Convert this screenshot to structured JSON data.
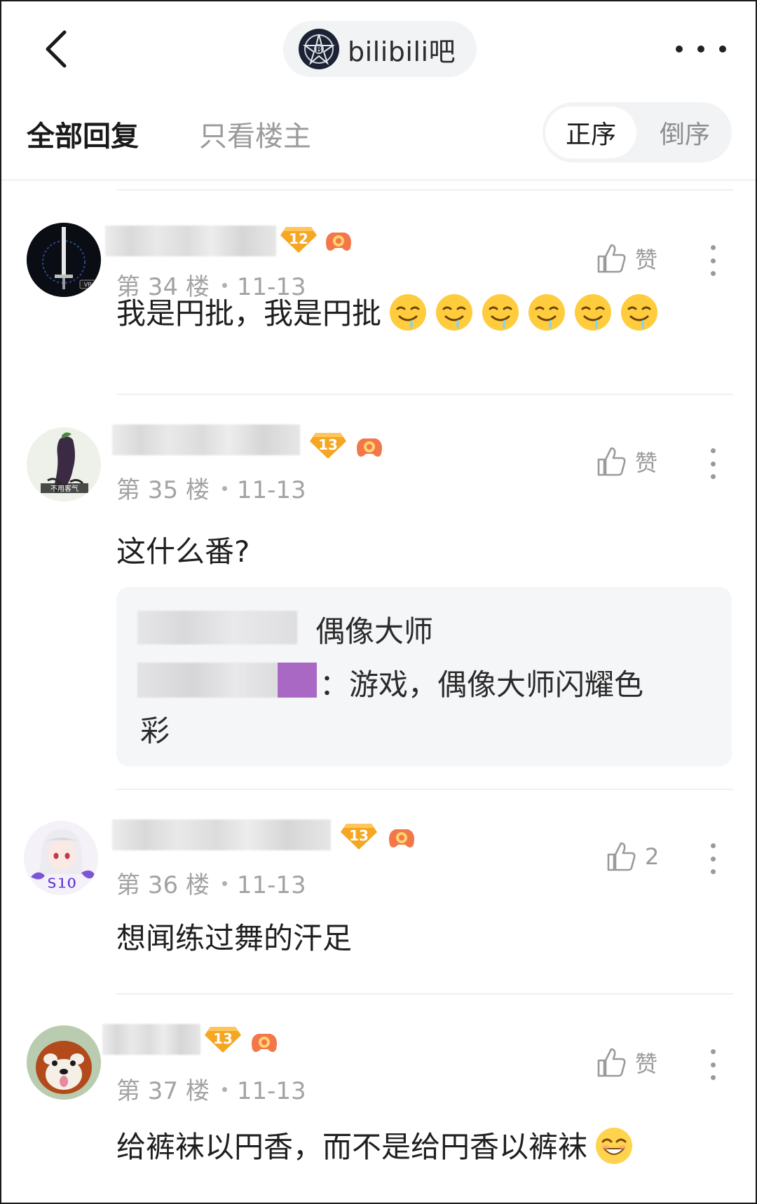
{
  "header": {
    "forum_name": "bilibili吧"
  },
  "tabs": {
    "all_replies": "全部回复",
    "owner_only": "只看楼主"
  },
  "sort": {
    "asc": "正序",
    "desc": "倒序"
  },
  "posts": [
    {
      "level": "12",
      "floor": "第 34 楼",
      "date": "11-13",
      "like": "赞",
      "text": "我是円批，我是円批",
      "emoji_count": 6,
      "emoji": "drooling-face"
    },
    {
      "level": "13",
      "floor": "第 35 楼",
      "date": "11-13",
      "like": "赞",
      "text": "这什么番?",
      "quote": {
        "title": "偶像大师",
        "line1": "：游戏，偶像大师闪耀色",
        "line2": "彩"
      }
    },
    {
      "level": "13",
      "floor": "第 36 楼",
      "date": "11-13",
      "like": "2",
      "text": "想闻练过舞的汗足"
    },
    {
      "level": "13",
      "floor": "第 37 楼",
      "date": "11-13",
      "like": "赞",
      "text": "给裤袜以円香，而不是给円香以裤袜",
      "emoji": "smirking-face"
    }
  ],
  "colors": {
    "level_badge": "#f5a623",
    "muted_text": "#a3a3a3",
    "quote_bg": "#f5f6f8",
    "pill_bg": "#f2f3f5"
  },
  "icons": [
    "back-chevron-icon",
    "forum-logo-icon",
    "more-icon",
    "thumb-up-icon",
    "kebab-icon",
    "level-badge-icon",
    "medal-icon"
  ]
}
